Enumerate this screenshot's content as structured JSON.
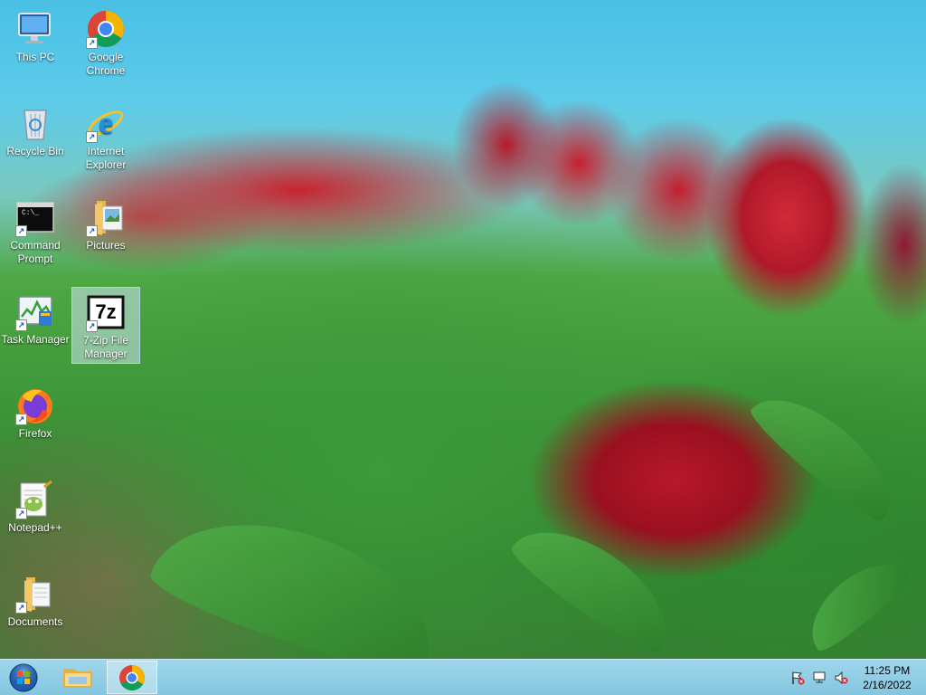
{
  "desktop": {
    "icons": [
      {
        "label": "This PC",
        "name": "this-pc-icon"
      },
      {
        "label": "Google Chrome",
        "name": "google-chrome-icon"
      },
      {
        "label": "Recycle Bin",
        "name": "recycle-bin-icon"
      },
      {
        "label": "Internet Explorer",
        "name": "internet-explorer-icon"
      },
      {
        "label": "Command Prompt",
        "name": "command-prompt-icon"
      },
      {
        "label": "Pictures",
        "name": "pictures-folder-icon"
      },
      {
        "label": "Task Manager",
        "name": "task-manager-icon"
      },
      {
        "label": "7-Zip File Manager",
        "name": "7zip-icon",
        "selected": true
      },
      {
        "label": "Firefox",
        "name": "firefox-icon"
      },
      {
        "label": "Notepad++",
        "name": "notepadpp-icon"
      },
      {
        "label": "Documents",
        "name": "documents-folder-icon"
      }
    ],
    "seven_zip_glyph_text": "7z",
    "cmd_glyph_text": "C:\\_"
  },
  "taskbar": {
    "start_icon": "windows-start-icon",
    "pinned": [
      {
        "name": "file-explorer-icon",
        "active": false
      },
      {
        "name": "google-chrome-icon",
        "active": true
      }
    ],
    "tray": [
      "action-center-flag-icon",
      "network-icon",
      "volume-muted-icon"
    ],
    "clock": {
      "time": "11:25 PM",
      "date": "2/16/2022"
    }
  },
  "colors": {
    "taskbar": "#84c6e0",
    "selection": "#cde4f0",
    "sky": "#49c0e4",
    "tulip": "#b8182a"
  }
}
